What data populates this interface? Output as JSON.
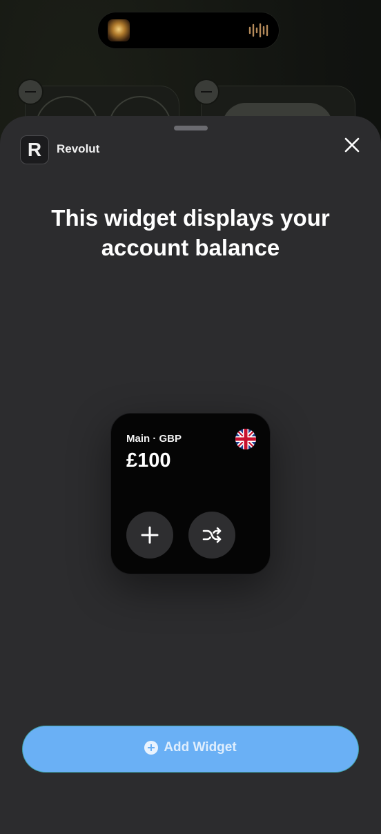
{
  "sheet": {
    "app_name": "Revolut",
    "app_icon_letter": "R",
    "headline": "This widget displays your account balance"
  },
  "widget": {
    "account": "Main · GBP",
    "balance": "£100",
    "flag_icon": "uk-flag-icon",
    "actions": [
      "plus-icon",
      "exchange-icon"
    ]
  },
  "footer": {
    "add_widget_label": "Add Widget",
    "accent": "#6ab0f5"
  }
}
